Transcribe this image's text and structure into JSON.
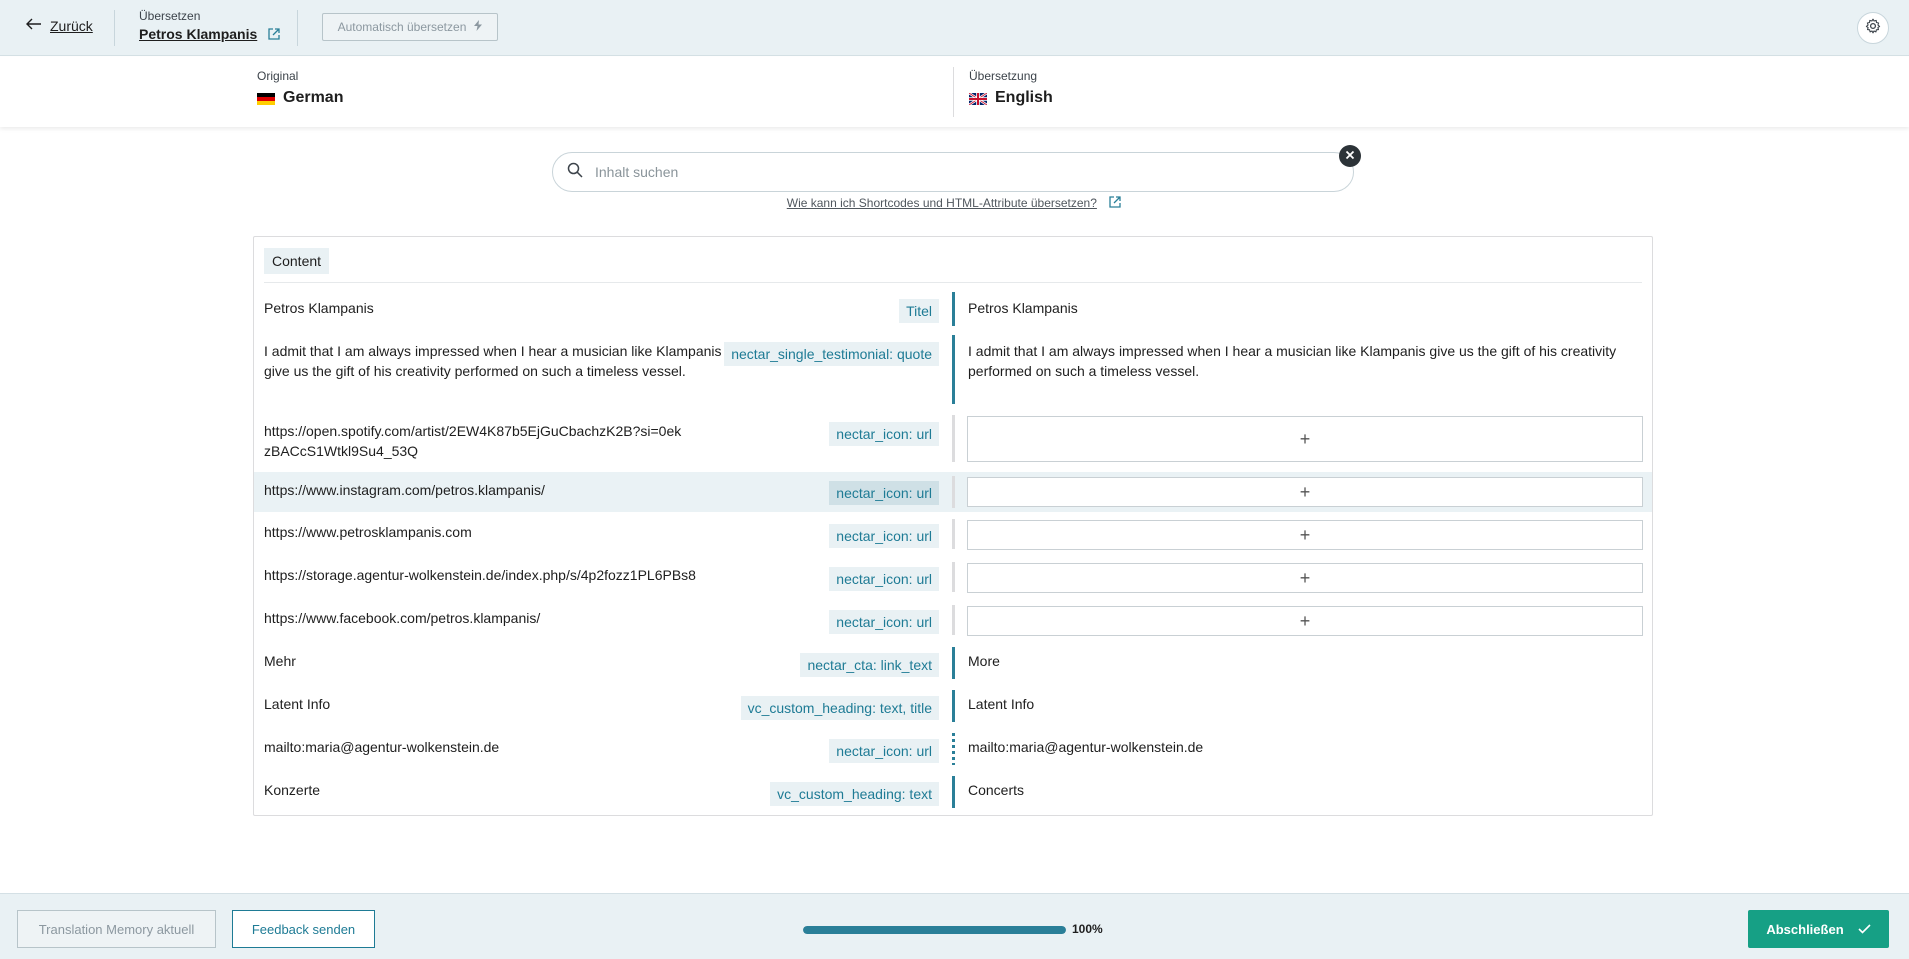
{
  "topbar": {
    "back_label": "Zurück",
    "crumb_label": "Übersetzen",
    "post_title": "Petros Klampanis",
    "auto_translate_label": "Automatisch übersetzen"
  },
  "languages": {
    "original_label": "Original",
    "original_name": "German",
    "translation_label": "Übersetzung",
    "translation_name": "English"
  },
  "search": {
    "placeholder": "Inhalt suchen",
    "help_link": "Wie kann ich Shortcodes und HTML-Attribute übersetzen?"
  },
  "section": {
    "label": "Content"
  },
  "rows": [
    {
      "source": "Petros Klampanis",
      "tag": "Titel",
      "target": "Petros Klampanis"
    },
    {
      "source": "I admit that I am always impressed when I hear a musician like Klampanis give us the gift of his creativity performed on such a timeless vessel.",
      "tag": "nectar_single_testimonial: quote",
      "target": "I admit that I am always impressed when I hear a musician like Klampanis give us the gift of his creativity performed on such a timeless vessel."
    },
    {
      "source": "https://open.spotify.com/artist/2EW4K87b5EjGuCbachzK2B?si=0ekzBACcS1Wtkl9Su4_53Q",
      "tag": "nectar_icon: url",
      "target": ""
    },
    {
      "source": "https://www.instagram.com/petros.klampanis/",
      "tag": "nectar_icon: url",
      "target": ""
    },
    {
      "source": "https://www.petrosklampanis.com",
      "tag": "nectar_icon: url",
      "target": ""
    },
    {
      "source": "https://storage.agentur-wolkenstein.de/index.php/s/4p2fozz1PL6PBs8",
      "tag": "nectar_icon: url",
      "target": ""
    },
    {
      "source": "https://www.facebook.com/petros.klampanis/",
      "tag": "nectar_icon: url",
      "target": ""
    },
    {
      "source": "Mehr",
      "tag": "nectar_cta: link_text",
      "target": "More"
    },
    {
      "source": "Latent Info",
      "tag": "vc_custom_heading: text, title",
      "target": "Latent Info"
    },
    {
      "source": "mailto:maria@agentur-wolkenstein.de",
      "tag": "nectar_icon: url",
      "target": "mailto:maria@agentur-wolkenstein.de"
    },
    {
      "source": "Konzerte",
      "tag": "vc_custom_heading: text",
      "target": "Concerts"
    }
  ],
  "add_symbol": "+",
  "footer": {
    "tm_label": "Translation Memory aktuell",
    "feedback_label": "Feedback senden",
    "progress_value": 100,
    "progress_text": "100%",
    "done_label": "Abschließen"
  },
  "colors": {
    "accent": "#2a7f98",
    "tag_text": "#1e7b95",
    "done": "#16a085",
    "header_bg": "#e9f1f4"
  },
  "icons": [
    "arrow-left-icon",
    "external-link-icon",
    "lightning-icon",
    "gear-icon",
    "flag-germany-icon",
    "flag-uk-icon",
    "search-icon",
    "close-icon",
    "plus-icon",
    "check-icon"
  ]
}
